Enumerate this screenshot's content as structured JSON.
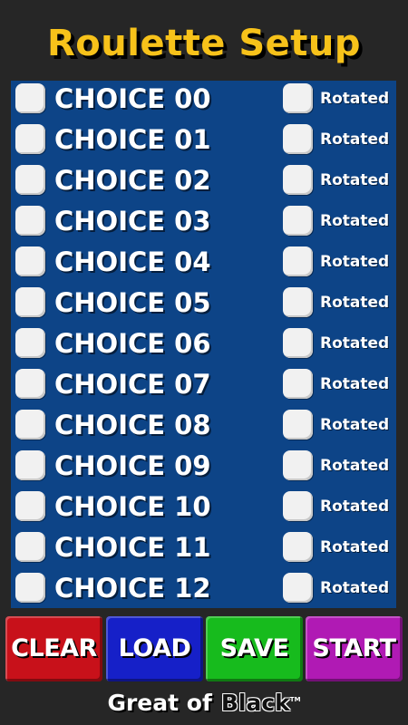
{
  "header": {
    "title": "Roulette Setup"
  },
  "choices": [
    {
      "label": "CHOICE 00",
      "rotated_label": "Rotated",
      "checked": false,
      "rotated": false
    },
    {
      "label": "CHOICE 01",
      "rotated_label": "Rotated",
      "checked": false,
      "rotated": false
    },
    {
      "label": "CHOICE 02",
      "rotated_label": "Rotated",
      "checked": false,
      "rotated": false
    },
    {
      "label": "CHOICE 03",
      "rotated_label": "Rotated",
      "checked": false,
      "rotated": false
    },
    {
      "label": "CHOICE 04",
      "rotated_label": "Rotated",
      "checked": false,
      "rotated": false
    },
    {
      "label": "CHOICE 05",
      "rotated_label": "Rotated",
      "checked": false,
      "rotated": false
    },
    {
      "label": "CHOICE 06",
      "rotated_label": "Rotated",
      "checked": false,
      "rotated": false
    },
    {
      "label": "CHOICE 07",
      "rotated_label": "Rotated",
      "checked": false,
      "rotated": false
    },
    {
      "label": "CHOICE 08",
      "rotated_label": "Rotated",
      "checked": false,
      "rotated": false
    },
    {
      "label": "CHOICE 09",
      "rotated_label": "Rotated",
      "checked": false,
      "rotated": false
    },
    {
      "label": "CHOICE 10",
      "rotated_label": "Rotated",
      "checked": false,
      "rotated": false
    },
    {
      "label": "CHOICE 11",
      "rotated_label": "Rotated",
      "checked": false,
      "rotated": false
    },
    {
      "label": "CHOICE 12",
      "rotated_label": "Rotated",
      "checked": false,
      "rotated": false
    }
  ],
  "buttons": {
    "clear": "CLEAR",
    "load": "LOAD",
    "save": "SAVE",
    "start": "START"
  },
  "footer": {
    "brand_part1": "Great of",
    "brand_part2": "Black",
    "trademark": "TM"
  },
  "colors": {
    "background": "#262626",
    "title": "#f7c21a",
    "panel": "#0d4487",
    "clear": "#c8111a",
    "load": "#1620c8",
    "save": "#17bb1d",
    "start": "#b01ab4"
  }
}
